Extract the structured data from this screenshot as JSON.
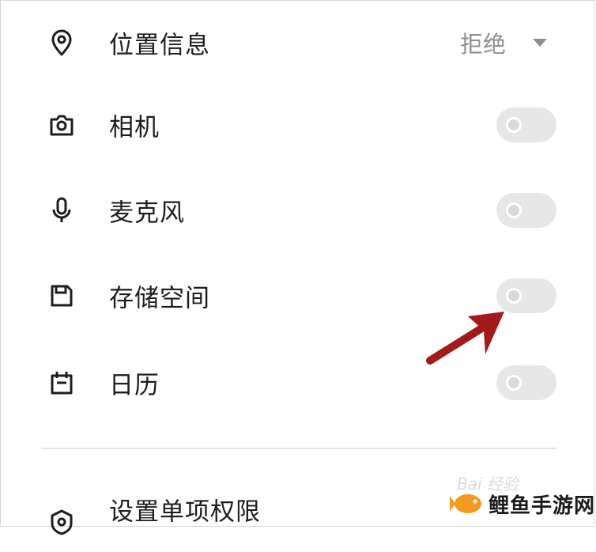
{
  "permissions": [
    {
      "label": "位置信息",
      "icon": "location-pin-icon",
      "control": "select",
      "value": "拒绝"
    },
    {
      "label": "相机",
      "icon": "camera-icon",
      "control": "toggle",
      "on": false
    },
    {
      "label": "麦克风",
      "icon": "microphone-icon",
      "control": "toggle",
      "on": false
    },
    {
      "label": "存储空间",
      "icon": "save-icon",
      "control": "toggle",
      "on": false
    },
    {
      "label": "日历",
      "icon": "calendar-icon",
      "control": "toggle",
      "on": false
    }
  ],
  "individual_permissions": {
    "label": "设置单项权限",
    "icon": "shield-icon"
  },
  "annotation": {
    "icon": "red-arrow-icon",
    "color": "#a31a1a",
    "points_to": "存储空间"
  },
  "watermark": {
    "baidu_text": "Bai 经验",
    "site_text": "鲤鱼手游网",
    "site_icon": "fish-logo-icon"
  },
  "colors": {
    "toggle_track": "#e6e6e6",
    "toggle_knob": "#d9d9d9",
    "muted_text": "#8e8e8e",
    "arrow": "#a31a1a",
    "fish": "#f39a1e"
  }
}
